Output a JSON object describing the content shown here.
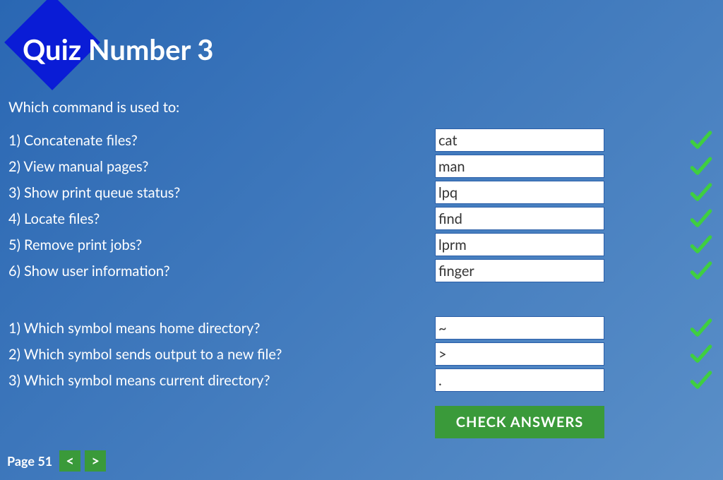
{
  "title": "Quiz Number 3",
  "section1": {
    "prompt": "Which command is used to:",
    "questions": [
      {
        "label": "1) Concatenate files?",
        "value": "cat",
        "correct": true
      },
      {
        "label": "2) View manual pages?",
        "value": "man",
        "correct": true
      },
      {
        "label": "3) Show print queue status?",
        "value": "lpq",
        "correct": true
      },
      {
        "label": "4) Locate files?",
        "value": "find",
        "correct": true
      },
      {
        "label": "5) Remove print jobs?",
        "value": "lprm",
        "correct": true
      },
      {
        "label": "6) Show user information?",
        "value": "finger",
        "correct": true
      }
    ]
  },
  "section2": {
    "questions": [
      {
        "label": "1) Which symbol means home directory?",
        "value": "~",
        "correct": true
      },
      {
        "label": "2) Which symbol sends output to a new file?",
        "value": ">",
        "correct": true
      },
      {
        "label": "3) Which symbol means current directory?",
        "value": ".",
        "correct": true
      }
    ]
  },
  "check_button_label": "CHECK ANSWERS",
  "footer": {
    "page_label": "Page 51",
    "prev_glyph": "<",
    "next_glyph": ">"
  }
}
